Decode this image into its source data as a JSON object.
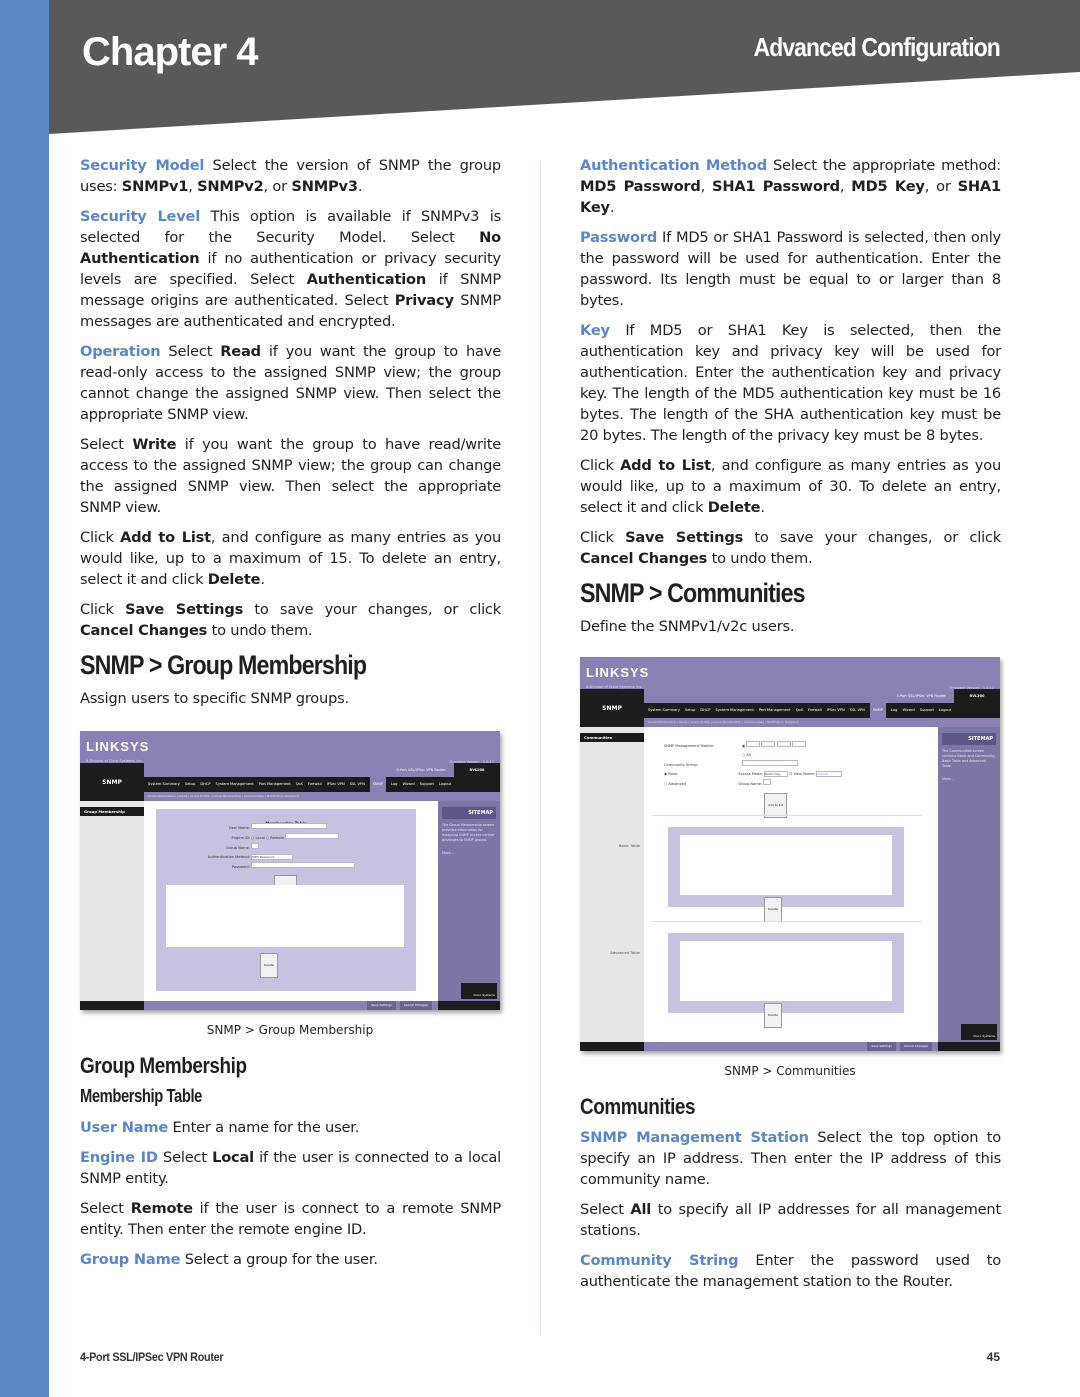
{
  "header": {
    "chapter": "Chapter 4",
    "section": "Advanced Configuration",
    "band_color": "#58595b",
    "accent_color": "#5b87c5"
  },
  "left": {
    "security_model": {
      "term": "Security Model",
      "t1": " Select the version of SNMP the group uses: ",
      "b1": "SNMPv1",
      "t2": ", ",
      "b2": "SNMPv2",
      "t3": ", or ",
      "b3": "SNMPv3",
      "t4": "."
    },
    "security_level": {
      "term": "Security Level",
      "t1": " This option is available if SNMPv3 is selected for the Security Model. Select ",
      "b1": "No Authentication",
      "t2": " if no authentication or privacy security levels are specified. Select ",
      "b2": "Authentication",
      "t3": " if SNMP message origins are authenticated. Select ",
      "b3": "Privacy",
      "t4": " SNMP messages are authenticated and encrypted."
    },
    "operation": {
      "term": "Operation",
      "t1": " Select ",
      "b1": "Read",
      "t2": " if you want the group to have read-only access to the assigned SNMP view; the group cannot change the assigned SNMP view. Then select the appropriate SNMP view."
    },
    "write": {
      "t1": "Select ",
      "b1": "Write",
      "t2": " if you want the group to have read/write access to the assigned SNMP view; the group can change the assigned SNMP view. Then select the appropriate SNMP view."
    },
    "add_list": {
      "t1": "Click ",
      "b1": "Add to List",
      "t2": ", and configure as many entries as you would like, up to a maximum of 15. To delete an entry, select it and click ",
      "b2": "Delete",
      "t3": "."
    },
    "save": {
      "t1": "Click ",
      "b1": "Save Settings",
      "t2": " to save your changes, or click ",
      "b2": "Cancel Changes",
      "t3": " to undo them."
    },
    "gm_heading": "SNMP > Group Membership",
    "gm_intro": "Assign users to specific SNMP groups.",
    "gm_caption": "SNMP > Group Membership",
    "gm_sub": "Group Membership",
    "mt_sub": "Membership Table",
    "user_name": {
      "term": "User Name",
      "t1": "  Enter a name for the user."
    },
    "engine_id": {
      "term": "Engine ID",
      "t1": "  Select ",
      "b1": "Local",
      "t2": " if the user is connected to a local SNMP entity."
    },
    "remote": {
      "t1": "Select ",
      "b1": "Remote",
      "t2": " if the user is connect to a remote SNMP entity. Then enter the remote engine ID."
    },
    "group_name": {
      "term": "Group Name",
      "t1": "  Select a group for the user."
    }
  },
  "right": {
    "auth_method": {
      "term": "Authentication Method",
      "t1": "  Select the appropriate method: ",
      "b1": "MD5 Password",
      "t2": ", ",
      "b2": "SHA1 Password",
      "t3": ", ",
      "b3": "MD5 Key",
      "t4": ", or ",
      "b4": "SHA1 Key",
      "t5": "."
    },
    "password": {
      "term": "Password",
      "t1": " If MD5 or SHA1 Password is selected, then only the password will be used for authentication. Enter the password. Its length must be equal to or larger than 8 bytes."
    },
    "key": {
      "term": "Key",
      "t1": "  If MD5 or SHA1 Key is selected, then the authentication key and privacy key will be used for authentication. Enter the authentication key and privacy key. The length of the MD5 authentication key must be 16 bytes. The length of the SHA authentication key must be 20 bytes. The length of the privacy key must be 8 bytes."
    },
    "add_list": {
      "t1": "Click ",
      "b1": "Add to List",
      "t2": ", and configure as many entries as you would like, up to a maximum of 30. To delete an entry, select it and click ",
      "b2": "Delete",
      "t3": "."
    },
    "save": {
      "t1": "Click ",
      "b1": "Save Settings",
      "t2": " to save your changes, or click ",
      "b2": "Cancel Changes",
      "t3": " to undo them."
    },
    "comm_heading": "SNMP > Communities",
    "comm_intro": "Define the SNMPv1/v2c users.",
    "comm_caption": "SNMP > Communities",
    "comm_sub": "Communities",
    "mgmt_station": {
      "term": "SNMP Management Station",
      "t1": "  Select the top option to specify an IP address. Then enter the IP address of this community name."
    },
    "all": {
      "t1": "Select ",
      "b1": "All",
      "t2": " to specify all IP addresses for all management stations."
    },
    "community_string": {
      "term": "Community String",
      "t1": " Enter the password used to authenticate the management station to the Router."
    }
  },
  "shots": {
    "common": {
      "logo": "LINKSYS",
      "logo_sub": "A Division of Cisco Systems, Inc.",
      "firmware": "Firmware Version : 1.0.17",
      "product": "4-Port SSL/IPSec VPN Router",
      "model": "RVL200",
      "nav_section": "SNMP",
      "tabs": [
        "System Summary",
        "Setup",
        "DHCP",
        "System Management",
        "Port Management",
        "QoS",
        "Firewall",
        "IPSec VPN",
        "SSL VPN",
        "SNMP",
        "Log",
        "Wizard",
        "Support",
        "Logout"
      ],
      "active_tab": "SNMP",
      "subtabs": "Global Parameters | Views | Group Profile | Group Membership | Communities | Notification Recipient",
      "sitemap": "SITEMAP",
      "more": "More...",
      "save_btn": "Save Settings",
      "cancel_btn": "Cancel Changes",
      "cisco": "Cisco Systems",
      "delete_btn": "Delete",
      "add_btn": "Add to list"
    },
    "gm": {
      "side_head": "Group Membership",
      "table_title": "Membership Table",
      "fields": [
        "User Name:",
        "Engine ID:",
        "Group Name:",
        "Authentication Method:",
        "Password:"
      ],
      "engine_local": "Local",
      "engine_remote": "Remote",
      "auth_value": "MD5 Password",
      "help": "The Group Membership screen provides information for assigning SNMP access control privileges to SNMP groups."
    },
    "comm": {
      "side_head": "Communities",
      "mgmt_label": "SNMP Management Station:",
      "all_label": "All",
      "community_label": "Community String:",
      "basic_label": "Basic",
      "advanced_label": "Advanced",
      "access_label": "Access Mode:",
      "access_value": "Read Only",
      "view_label": "View Name:",
      "view_value": "default",
      "group_label": "Group Name:",
      "basic_table": "Basic Table",
      "advanced_table": "Advanced Table",
      "help": "The Communities screen contains Basic and Community, Basic Table and Advanced Table."
    }
  },
  "footer": {
    "product": "4-Port SSL/IPSec VPN Router",
    "page": "45"
  }
}
